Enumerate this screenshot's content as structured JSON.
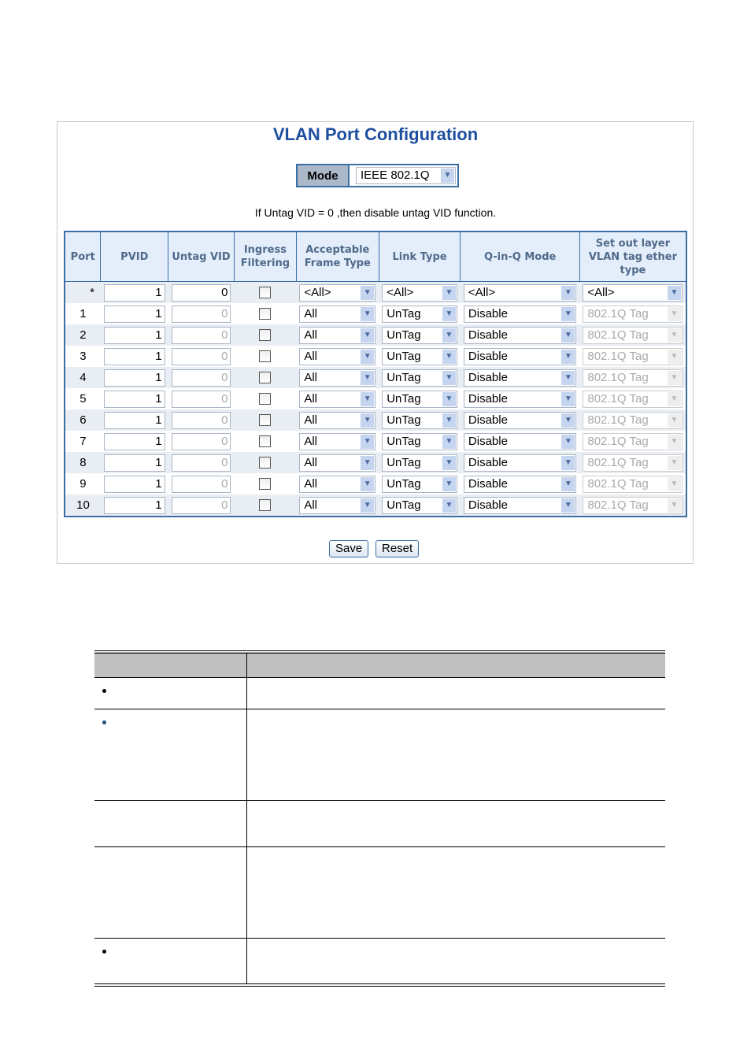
{
  "title": "VLAN Port Configuration",
  "mode": {
    "label": "Mode",
    "value": "IEEE 802.1Q"
  },
  "note": "If Untag VID = 0 ,then disable untag VID function.",
  "columns": [
    "Port",
    "PVID",
    "Untag VID",
    "Ingress Filtering",
    "Acceptable Frame Type",
    "Link Type",
    "Q-in-Q Mode",
    "Set out layer VLAN tag ether type"
  ],
  "all_row": {
    "port": "*",
    "pvid": "1",
    "untag": "0",
    "ingress": false,
    "frame": "<All>",
    "link": "<All>",
    "qinq": "<All>",
    "ethertype": "<All>"
  },
  "rows": [
    {
      "port": "1",
      "pvid": "1",
      "untag": "0",
      "ingress": false,
      "frame": "All",
      "link": "UnTag",
      "qinq": "Disable",
      "ethertype": "802.1Q Tag"
    },
    {
      "port": "2",
      "pvid": "1",
      "untag": "0",
      "ingress": false,
      "frame": "All",
      "link": "UnTag",
      "qinq": "Disable",
      "ethertype": "802.1Q Tag"
    },
    {
      "port": "3",
      "pvid": "1",
      "untag": "0",
      "ingress": false,
      "frame": "All",
      "link": "UnTag",
      "qinq": "Disable",
      "ethertype": "802.1Q Tag"
    },
    {
      "port": "4",
      "pvid": "1",
      "untag": "0",
      "ingress": false,
      "frame": "All",
      "link": "UnTag",
      "qinq": "Disable",
      "ethertype": "802.1Q Tag"
    },
    {
      "port": "5",
      "pvid": "1",
      "untag": "0",
      "ingress": false,
      "frame": "All",
      "link": "UnTag",
      "qinq": "Disable",
      "ethertype": "802.1Q Tag"
    },
    {
      "port": "6",
      "pvid": "1",
      "untag": "0",
      "ingress": false,
      "frame": "All",
      "link": "UnTag",
      "qinq": "Disable",
      "ethertype": "802.1Q Tag"
    },
    {
      "port": "7",
      "pvid": "1",
      "untag": "0",
      "ingress": false,
      "frame": "All",
      "link": "UnTag",
      "qinq": "Disable",
      "ethertype": "802.1Q Tag"
    },
    {
      "port": "8",
      "pvid": "1",
      "untag": "0",
      "ingress": false,
      "frame": "All",
      "link": "UnTag",
      "qinq": "Disable",
      "ethertype": "802.1Q Tag"
    },
    {
      "port": "9",
      "pvid": "1",
      "untag": "0",
      "ingress": false,
      "frame": "All",
      "link": "UnTag",
      "qinq": "Disable",
      "ethertype": "802.1Q Tag"
    },
    {
      "port": "10",
      "pvid": "1",
      "untag": "0",
      "ingress": false,
      "frame": "All",
      "link": "UnTag",
      "qinq": "Disable",
      "ethertype": "802.1Q Tag"
    }
  ],
  "buttons": {
    "save": "Save",
    "reset": "Reset"
  },
  "desc_rows": [
    {
      "bullet": true
    },
    {
      "bullet": true,
      "bullet_color": "#1f4f7f"
    },
    {
      "bullet": false
    },
    {
      "bullet": false
    },
    {
      "bullet": true
    }
  ]
}
